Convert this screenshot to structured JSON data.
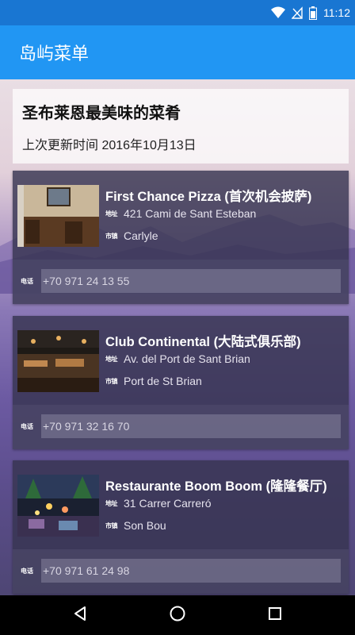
{
  "status_bar": {
    "time": "11:12",
    "icons": [
      "wifi-icon",
      "no-signal-icon",
      "battery-icon"
    ]
  },
  "app_bar": {
    "title": "岛屿菜单"
  },
  "header": {
    "title": "圣布莱恩最美味的菜肴",
    "updated": "上次更新时间 2016年10月13日"
  },
  "labels": {
    "address_tag": "地址",
    "city_tag": "市镇",
    "phone_tag": "电话"
  },
  "restaurants": [
    {
      "name": "First Chance Pizza (首次机会披萨)",
      "address": "421 Cami de Sant Esteban",
      "city": "Carlyle",
      "phone": "+70 971 24 13 55"
    },
    {
      "name": "Club Continental (大陆式俱乐部)",
      "address": "Av. del Port de Sant Brian",
      "city": "Port de St Brian",
      "phone": "+70 971 32 16 70"
    },
    {
      "name": "Restaurante Boom Boom (隆隆餐厅)",
      "address": "31 Carrer Carreró",
      "city": "Son Bou",
      "phone": "+70 971 61 24 98"
    }
  ],
  "nav": {
    "icons": [
      "back-icon",
      "home-icon",
      "recents-icon"
    ]
  },
  "colors": {
    "status_bar": "#1976d2",
    "app_bar": "#2196f3",
    "card": "#373450"
  }
}
